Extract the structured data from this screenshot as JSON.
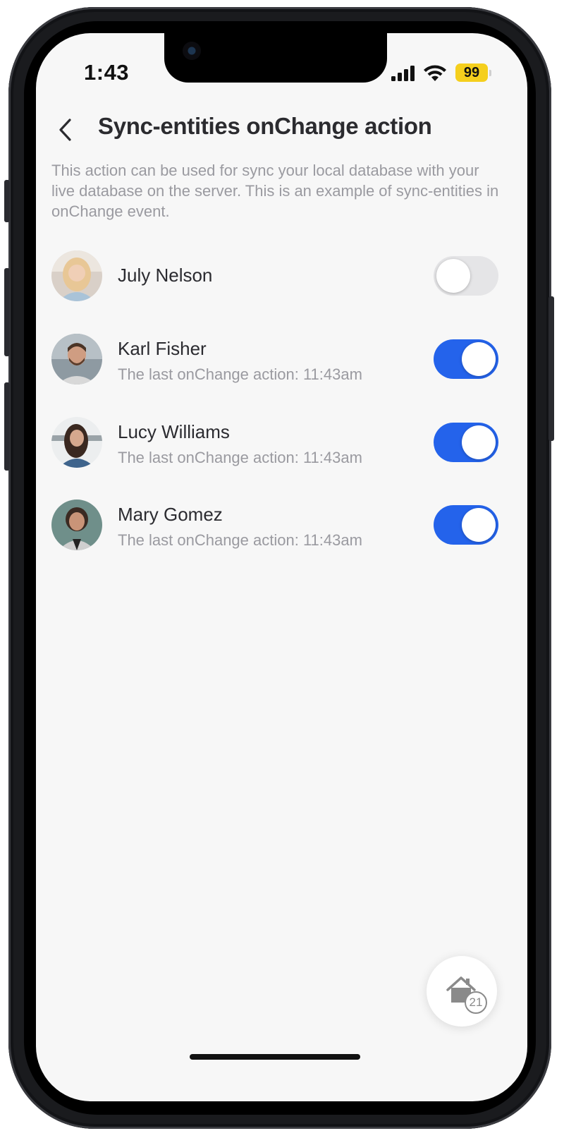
{
  "status_bar": {
    "time": "1:43",
    "battery": "99"
  },
  "header": {
    "title": "Sync-entities onChange action",
    "back_icon": "chevron-left-icon"
  },
  "description": "This action can be used for sync your local database with your live database on the server. This is an example of sync-entities in onChange event.",
  "users": [
    {
      "name": "July Nelson",
      "subtitle": "",
      "enabled": false,
      "avatar_colors": [
        "#d7c9bd",
        "#f2dcc0"
      ]
    },
    {
      "name": "Karl Fisher",
      "subtitle": "The last onChange action: 11:43am",
      "enabled": true,
      "avatar_colors": [
        "#8f9aa1",
        "#c8a08a"
      ]
    },
    {
      "name": "Lucy Williams",
      "subtitle": "The last onChange action: 11:43am",
      "enabled": true,
      "avatar_colors": [
        "#e7e9ea",
        "#3b5a7c"
      ]
    },
    {
      "name": "Mary Gomez",
      "subtitle": "The last onChange action: 11:43am",
      "enabled": true,
      "avatar_colors": [
        "#6f8f8a",
        "#c9c9c9"
      ]
    }
  ],
  "fab": {
    "icon": "home-icon",
    "count": "21"
  },
  "colors": {
    "accent": "#2463eb",
    "toggle_off": "#e5e5e7",
    "background": "#f7f7f7"
  }
}
